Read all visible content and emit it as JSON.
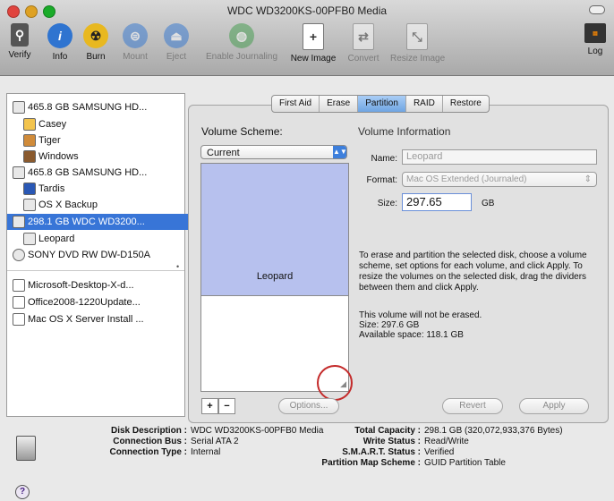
{
  "window": {
    "title": "WDC WD3200KS-00PFB0 Media"
  },
  "toolbar": {
    "verify": "Verify",
    "info": "Info",
    "burn": "Burn",
    "mount": "Mount",
    "eject": "Eject",
    "enable_journaling": "Enable Journaling",
    "new_image": "New Image",
    "convert": "Convert",
    "resize_image": "Resize Image",
    "log": "Log"
  },
  "sidebar": {
    "items": [
      {
        "label": "465.8 GB SAMSUNG HD..."
      },
      {
        "label": "Casey"
      },
      {
        "label": "Tiger"
      },
      {
        "label": "Windows"
      },
      {
        "label": "465.8 GB SAMSUNG HD..."
      },
      {
        "label": "Tardis"
      },
      {
        "label": "OS X Backup"
      },
      {
        "label": "298.1 GB WDC WD3200..."
      },
      {
        "label": "Leopard"
      },
      {
        "label": "SONY DVD RW DW-D150A"
      },
      {
        "label": "Microsoft-Desktop-X-d..."
      },
      {
        "label": "Office2008-1220Update..."
      },
      {
        "label": "Mac OS X Server Install ..."
      }
    ]
  },
  "tabs": [
    "First Aid",
    "Erase",
    "Partition",
    "RAID",
    "Restore"
  ],
  "partition": {
    "volume_scheme_label": "Volume Scheme:",
    "scheme_value": "Current",
    "partition_name": "Leopard",
    "options_button": "Options...",
    "plus": "+",
    "minus": "−",
    "revert_button": "Revert",
    "apply_button": "Apply"
  },
  "volume_info": {
    "heading": "Volume Information",
    "name_label": "Name:",
    "name_value": "Leopard",
    "format_label": "Format:",
    "format_value": "Mac OS Extended (Journaled)",
    "size_label": "Size:",
    "size_value": "297.65",
    "size_unit": "GB",
    "description": "To erase and partition the selected disk, choose a volume scheme, set options for each volume, and click Apply. To resize the volumes on the selected disk, drag the dividers between them and click Apply.",
    "erase_line1": "This volume will not be erased.",
    "erase_line2": "Size: 297.6 GB",
    "erase_line3": "Available space: 118.1 GB"
  },
  "disk_info": {
    "desc_label": "Disk Description :",
    "desc_value": "WDC WD3200KS-00PFB0 Media",
    "bus_label": "Connection Bus :",
    "bus_value": "Serial ATA 2",
    "type_label": "Connection Type :",
    "type_value": "Internal",
    "capacity_label": "Total Capacity :",
    "capacity_value": "298.1 GB (320,072,933,376 Bytes)",
    "write_label": "Write Status :",
    "write_value": "Read/Write",
    "smart_label": "S.M.A.R.T. Status :",
    "smart_value": "Verified",
    "scheme_label": "Partition Map Scheme :",
    "scheme_value": "GUID Partition Table"
  },
  "help": "?"
}
